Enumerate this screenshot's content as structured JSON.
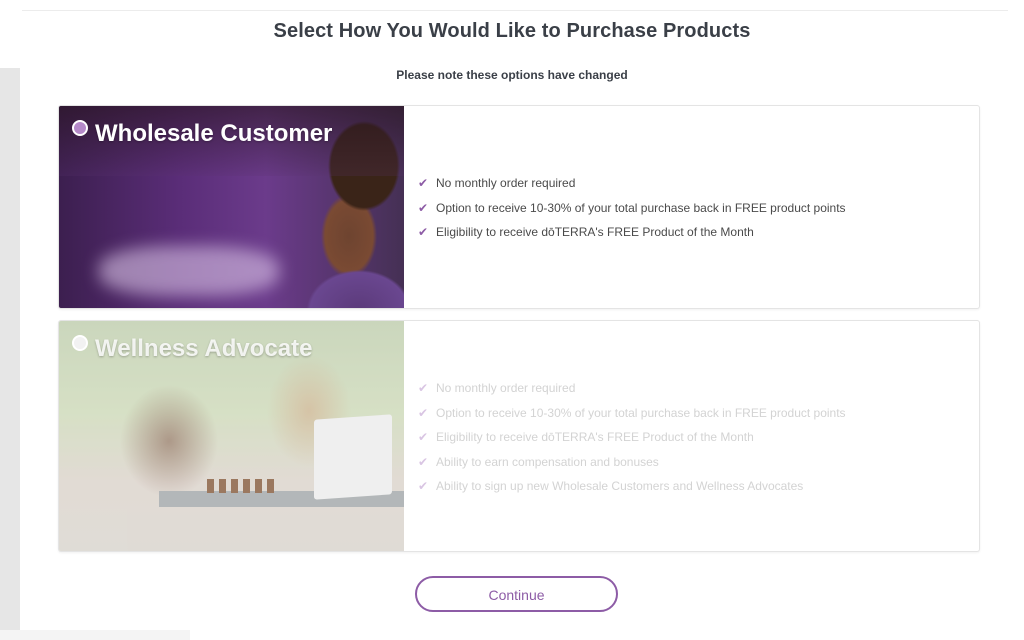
{
  "header": {
    "title": "Select How You Would Like to Purchase Products",
    "subtitle": "Please note these options have changed"
  },
  "options": [
    {
      "title": "Wholesale Customer",
      "selected": true,
      "benefits": [
        "No monthly order required",
        "Option to receive 10-30% of your total purchase back in FREE product points",
        "Eligibility to receive dōTERRA's FREE Product of the Month"
      ]
    },
    {
      "title": "Wellness Advocate",
      "selected": false,
      "benefits": [
        "No monthly order required",
        "Option to receive 10-30% of your total purchase back in FREE product points",
        "Eligibility to receive dōTERRA's FREE Product of the Month",
        "Ability to earn compensation and bonuses",
        "Ability to sign up new Wholesale Customers and Wellness Advocates"
      ]
    }
  ],
  "footer": {
    "continue_label": "Continue"
  },
  "colors": {
    "accent": "#8d5ca6",
    "title_text": "#3a3f47"
  },
  "icons": {
    "check": "check-icon",
    "radio": "radio-icon"
  }
}
